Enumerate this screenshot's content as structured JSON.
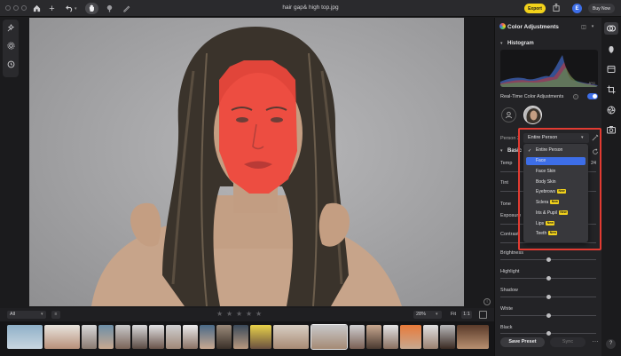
{
  "window": {
    "title": "hair gap& high top.jpg",
    "export_label": "Export",
    "account_initial": "E",
    "buy_now_label": "Buy Now"
  },
  "toolbar_icons": [
    "home-icon",
    "add-icon",
    "undo-icon",
    "hand-icon",
    "mask-brush-icon",
    "pencil-icon"
  ],
  "left_tools": [
    "ai-enhance-icon",
    "settings-icon",
    "history-icon"
  ],
  "bottom_bar": {
    "filter_value": "All",
    "zoom_value": "28%",
    "fit_label": "Fit",
    "one_to_one_label": "1:1",
    "stars": [
      "★",
      "★",
      "★",
      "★",
      "★"
    ]
  },
  "panel": {
    "title": "Color Adjustments",
    "histogram_title": "Histogram",
    "histogram_tag": "JPG",
    "realtime_label": "Real-Time Color Adjustments",
    "realtime_enabled": true,
    "person_label": "Person 2",
    "person_select_value": "Entire Person",
    "basic_title": "Basic",
    "params": [
      {
        "label": "Temp",
        "value": "24"
      },
      {
        "label": "Tint",
        "value": ""
      },
      {
        "label": "Tone",
        "value": ""
      },
      {
        "label": "Exposure",
        "value": ""
      },
      {
        "label": "Contrast",
        "value": ""
      },
      {
        "label": "Brightness",
        "value": ""
      },
      {
        "label": "Highlight",
        "value": ""
      },
      {
        "label": "Shadow",
        "value": ""
      },
      {
        "label": "White",
        "value": ""
      },
      {
        "label": "Black",
        "value": ""
      }
    ],
    "save_preset_label": "Save Preset",
    "sync_label": "Sync"
  },
  "dropdown": {
    "items": [
      {
        "label": "Entire Person",
        "checked": true,
        "highlighted": false,
        "new": false
      },
      {
        "label": "Face",
        "checked": false,
        "highlighted": true,
        "new": false
      },
      {
        "label": "Face Skin",
        "checked": false,
        "highlighted": false,
        "new": false
      },
      {
        "label": "Body Skin",
        "checked": false,
        "highlighted": false,
        "new": false
      },
      {
        "label": "Eyebrows",
        "checked": false,
        "highlighted": false,
        "new": true
      },
      {
        "label": "Sclera",
        "checked": false,
        "highlighted": false,
        "new": true
      },
      {
        "label": "Iris & Pupil",
        "checked": false,
        "highlighted": false,
        "new": true
      },
      {
        "label": "Lips",
        "checked": false,
        "highlighted": false,
        "new": true
      },
      {
        "label": "Teeth",
        "checked": false,
        "highlighted": false,
        "new": true
      }
    ],
    "new_badge": "New",
    "check_glyph": "✓"
  },
  "right_strip_icons": [
    "color-adjust-icon",
    "face-icon",
    "layers-icon",
    "crop-icon",
    "aperture-icon",
    "camera-icon"
  ],
  "colors": {
    "accent": "#3d6ee8",
    "export": "#f2d21b",
    "highlight_box": "#e23b32",
    "face_mask": "#f0463c"
  }
}
